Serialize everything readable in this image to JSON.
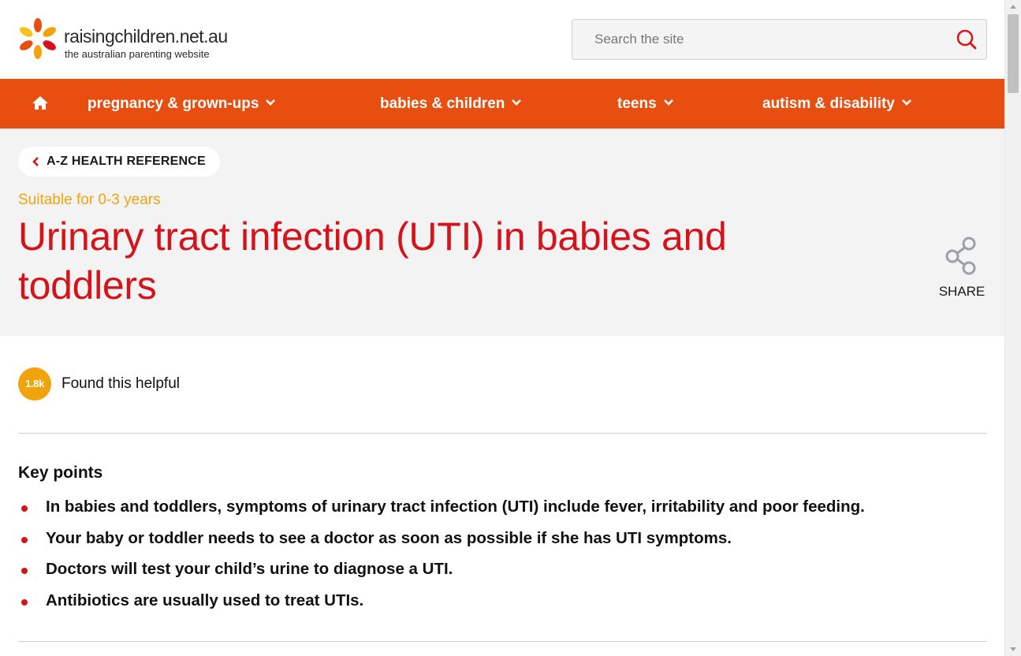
{
  "header": {
    "logo_name": "raisingchildren.net.au",
    "logo_tagline": "the australian parenting website",
    "logo_icon": "flower-logo-icon",
    "search_placeholder": "Search the site",
    "search_icon": "search-icon"
  },
  "nav": {
    "home_icon": "home-icon",
    "items": [
      {
        "label": "pregnancy & grown-ups"
      },
      {
        "label": "babies & children"
      },
      {
        "label": "teens"
      },
      {
        "label": "autism & disability"
      }
    ],
    "background": "#e84e0f"
  },
  "hero": {
    "breadcrumb": "A-Z HEALTH REFERENCE",
    "suitable": "Suitable for 0-3 years",
    "title": "Urinary tract infection (UTI) in babies and toddlers",
    "share_label": "SHARE",
    "share_icon": "share-icon"
  },
  "helpful": {
    "count": "1.8k",
    "label": "Found this helpful"
  },
  "key_points": {
    "title": "Key points",
    "items": [
      "In babies and toddlers, symptoms of urinary tract infection (UTI) include fever, irritability and poor feeding.",
      "Your baby or toddler needs to see a doctor as soon as possible if she has UTI symptoms.",
      "Doctors will test your child’s urine to diagnose a UTI.",
      "Antibiotics are usually used to treat UTIs."
    ]
  },
  "colors": {
    "accent_red": "#d6131b",
    "accent_orange": "#e84e0f",
    "accent_yellow": "#f0a30a",
    "hero_background": "#f3f3f3"
  }
}
